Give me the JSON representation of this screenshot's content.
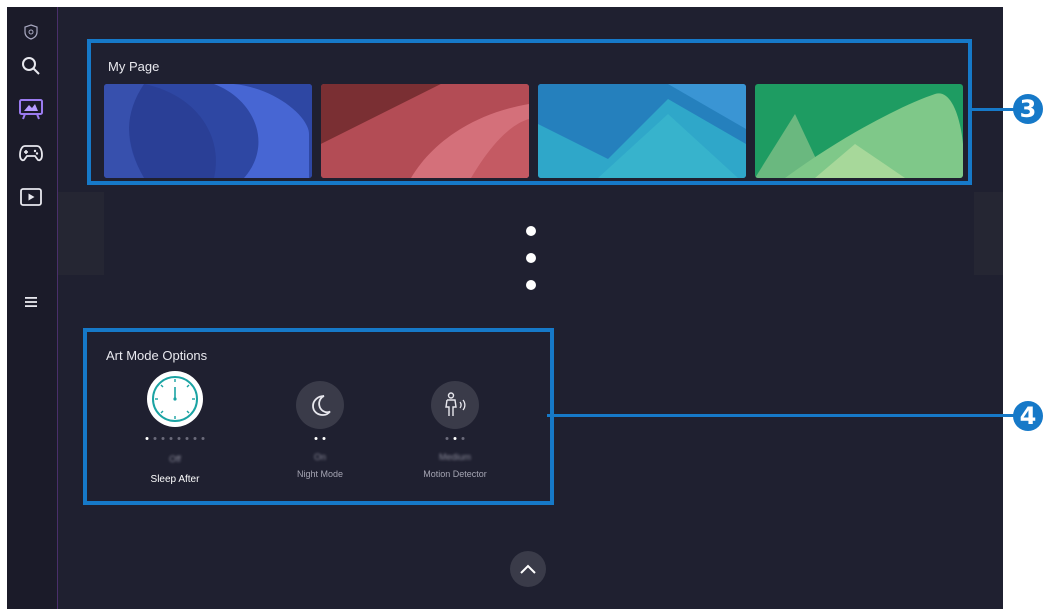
{
  "my_page": {
    "title": "My Page"
  },
  "art_mode": {
    "title": "Art Mode Options",
    "options": [
      {
        "label": "Sleep After",
        "value": "Off",
        "icon": "clock-icon"
      },
      {
        "label": "Night Mode",
        "value": "On",
        "icon": "moon-icon"
      },
      {
        "label": "Motion Detector",
        "value": "Medium",
        "icon": "motion-sensor-icon"
      }
    ]
  },
  "callouts": {
    "c3": "3",
    "c4": "4"
  },
  "colors": {
    "accent": "#1679c8",
    "screen_bg": "#1f2030",
    "sidebar_border": "#4a2f6a"
  }
}
